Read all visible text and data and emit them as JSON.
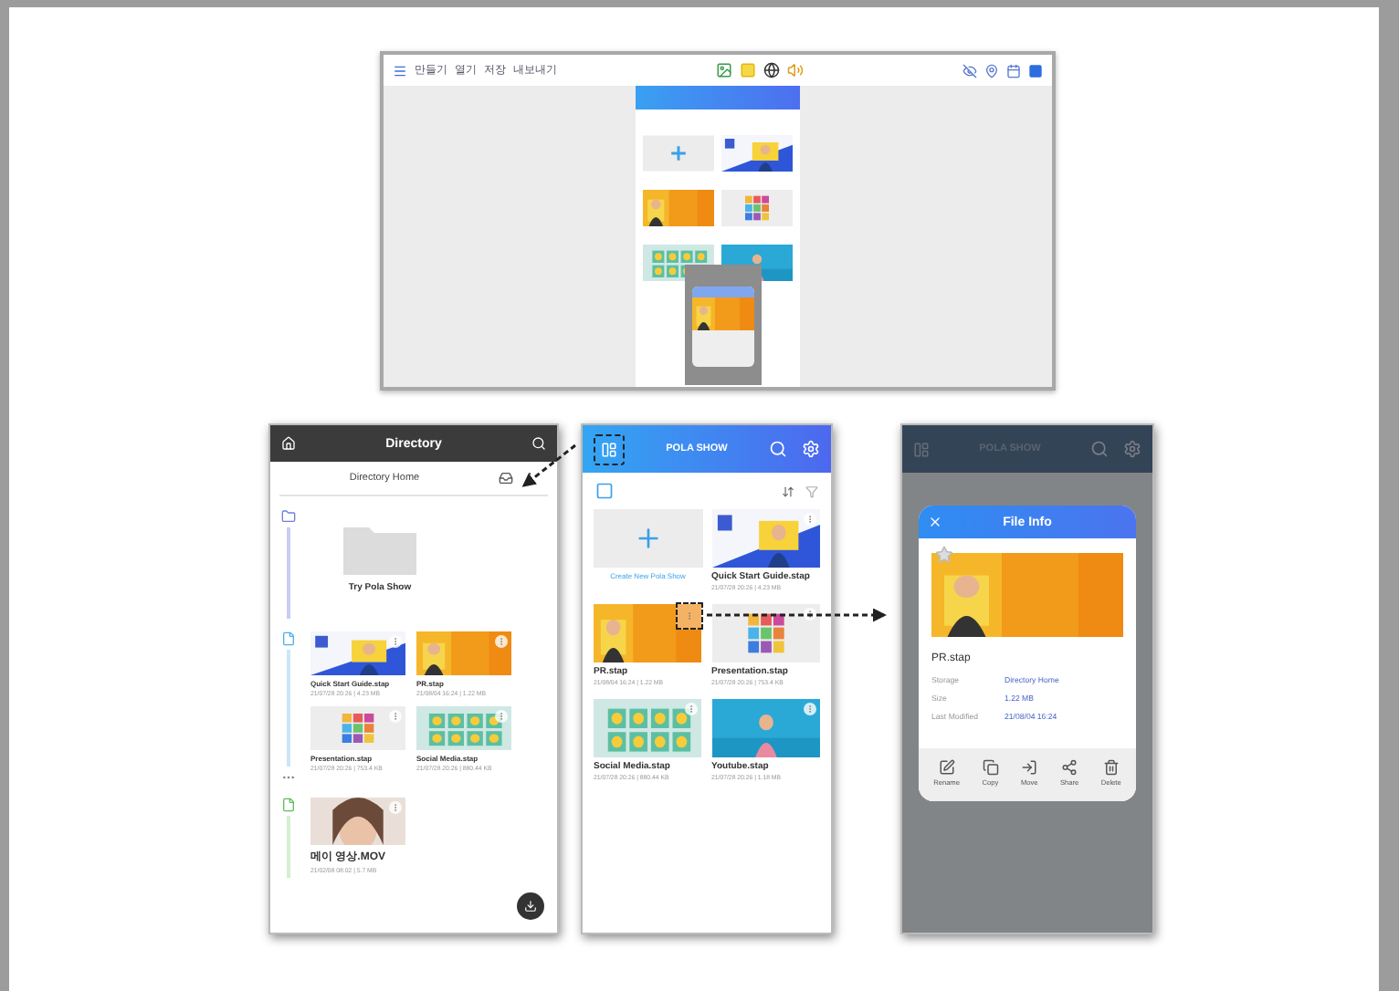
{
  "desktop_preview": {
    "menu": [
      "만들기",
      "열기",
      "저장",
      "내보내기"
    ]
  },
  "directory_screen": {
    "title": "Directory",
    "path": "Directory Home",
    "folders": [
      {
        "name": "Try Pola Show"
      }
    ],
    "files": [
      {
        "name": "Quick Start Guide.stap",
        "meta": "21/07/28 20:26 | 4.23 MB"
      },
      {
        "name": "PR.stap",
        "meta": "21/08/04 16:24 | 1.22 MB"
      },
      {
        "name": "Presentation.stap",
        "meta": "21/07/28 20:26 | 753.4 KB"
      },
      {
        "name": "Social Media.stap",
        "meta": "21/07/28 20:26 | 880.44 KB"
      }
    ],
    "videos": [
      {
        "name": "메이 영상.MOV",
        "meta": "21/02/08 08:02 | 5.7 MB"
      }
    ]
  },
  "home_screen": {
    "logo": "POLA SHOW",
    "menu_highlighted": true,
    "create_label": "Create New Pola Show",
    "files": [
      {
        "name": "Quick Start Guide.stap",
        "meta": "21/07/28 20:26 | 4.23 MB",
        "highlighted": false
      },
      {
        "name": "PR.stap",
        "meta": "21/08/04 16:24 | 1.22 MB",
        "highlighted": true
      },
      {
        "name": "Presentation.stap",
        "meta": "21/07/28 20:26 | 753.4 KB",
        "highlighted": false
      },
      {
        "name": "Social Media.stap",
        "meta": "21/07/28 20:26 | 880.44 KB",
        "highlighted": false
      },
      {
        "name": "Youtube.stap",
        "meta": "21/07/28 20:26 | 1.18 MB",
        "highlighted": false
      }
    ]
  },
  "file_info": {
    "background_logo": "POLA SHOW",
    "title": "File Info",
    "file_name": "PR.stap",
    "details": [
      {
        "label": "Storage",
        "value": "Directory Home"
      },
      {
        "label": "Size",
        "value": "1.22 MB"
      },
      {
        "label": "Last Modified",
        "value": "21/08/04 16:24"
      }
    ],
    "actions": [
      "Rename",
      "Copy",
      "Move",
      "Share",
      "Delete"
    ]
  }
}
